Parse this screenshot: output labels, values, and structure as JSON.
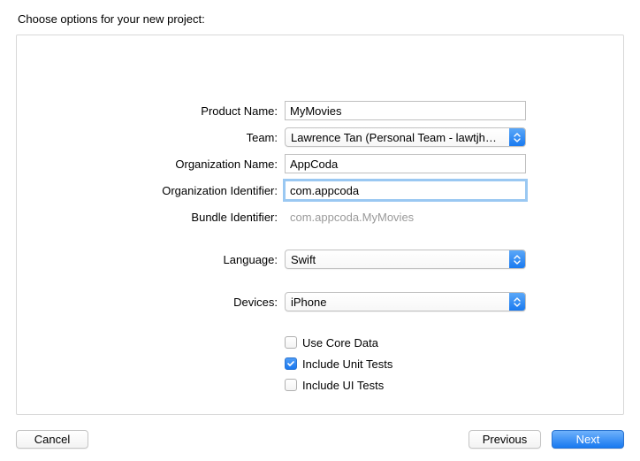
{
  "header": {
    "title": "Choose options for your new project:"
  },
  "form": {
    "productName": {
      "label": "Product Name:",
      "value": "MyMovies"
    },
    "team": {
      "label": "Team:",
      "value": "Lawrence Tan (Personal Team - lawtjh@g..."
    },
    "orgName": {
      "label": "Organization Name:",
      "value": "AppCoda"
    },
    "orgIdentifier": {
      "label": "Organization Identifier:",
      "value": "com.appcoda"
    },
    "bundleIdentifier": {
      "label": "Bundle Identifier:",
      "value": "com.appcoda.MyMovies"
    },
    "language": {
      "label": "Language:",
      "value": "Swift"
    },
    "devices": {
      "label": "Devices:",
      "value": "iPhone"
    },
    "useCoreData": {
      "label": "Use Core Data",
      "checked": false
    },
    "includeUnitTests": {
      "label": "Include Unit Tests",
      "checked": true
    },
    "includeUITests": {
      "label": "Include UI Tests",
      "checked": false
    }
  },
  "footer": {
    "cancel": "Cancel",
    "previous": "Previous",
    "next": "Next"
  }
}
